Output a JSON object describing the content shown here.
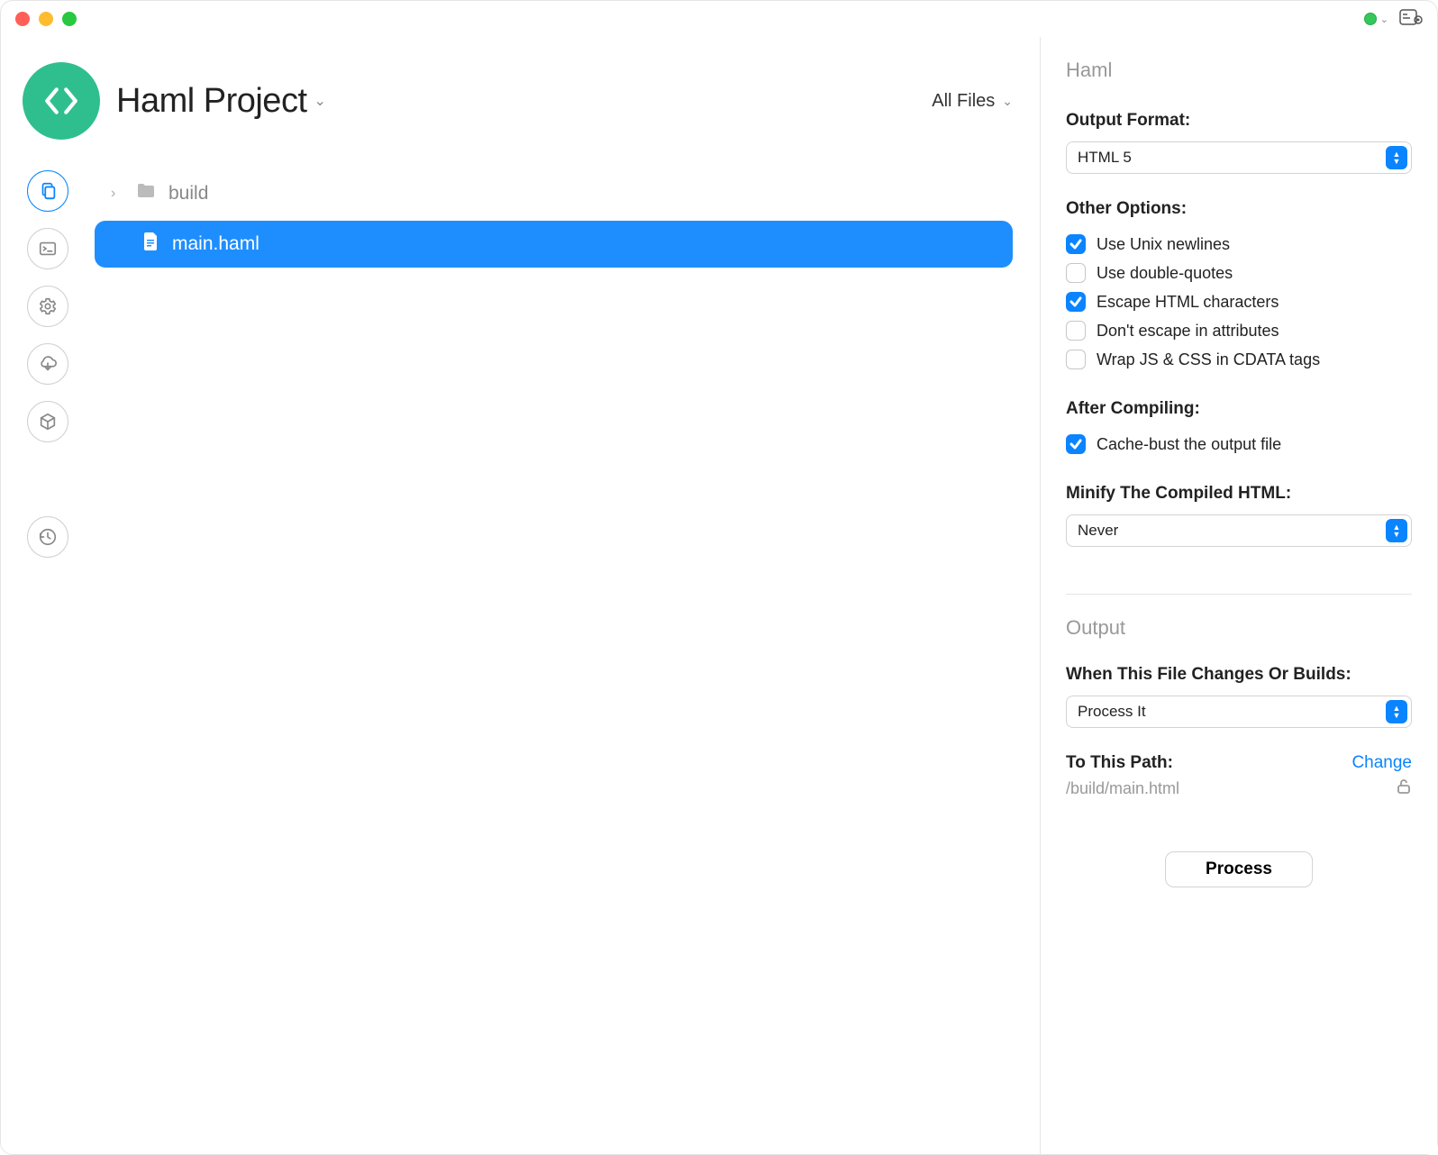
{
  "project": {
    "title": "Haml Project"
  },
  "header": {
    "all_files_label": "All Files"
  },
  "files": {
    "folder_name": "build",
    "selected_file": "main.haml"
  },
  "panel": {
    "heading": "Haml",
    "output_format_label": "Output Format:",
    "output_format_value": "HTML 5",
    "other_options_label": "Other Options:",
    "options": {
      "unix_newlines": {
        "label": "Use Unix newlines",
        "checked": true
      },
      "double_quotes": {
        "label": "Use double-quotes",
        "checked": false
      },
      "escape_html": {
        "label": "Escape HTML characters",
        "checked": true
      },
      "no_escape_attrs": {
        "label": "Don't escape in attributes",
        "checked": false
      },
      "wrap_cdata": {
        "label": "Wrap JS & CSS in CDATA tags",
        "checked": false
      }
    },
    "after_compiling_label": "After Compiling:",
    "cache_bust": {
      "label": "Cache-bust the output file",
      "checked": true
    },
    "minify_label": "Minify The Compiled HTML:",
    "minify_value": "Never",
    "output_heading": "Output",
    "when_changes_label": "When This File Changes Or Builds:",
    "when_changes_value": "Process It",
    "to_path_label": "To This Path:",
    "change_link": "Change",
    "output_path": "/build/main.html",
    "process_button": "Process"
  }
}
